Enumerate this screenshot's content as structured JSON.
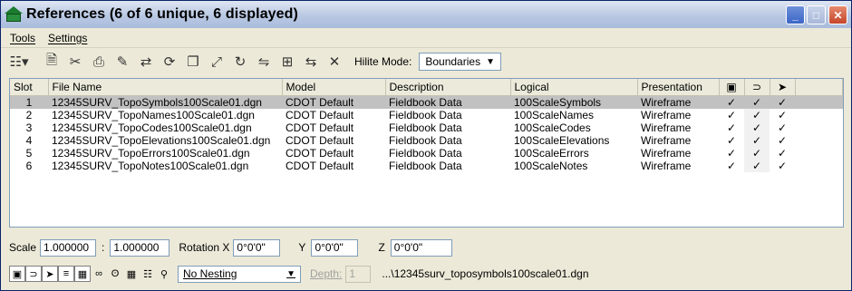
{
  "window": {
    "title": "References (6 of 6 unique, 6 displayed)",
    "minimize_glyph": "_",
    "maximize_glyph": "□",
    "close_glyph": "✕"
  },
  "menu": {
    "items": [
      "Tools",
      "Settings"
    ]
  },
  "toolbar": {
    "icons": [
      "tree-list-icon",
      "attach-icon",
      "detach-icon",
      "print-icon",
      "clip-icon",
      "move-icon",
      "reload-icon",
      "copy-icon",
      "scale-icon",
      "rotate-icon",
      "mirror-icon",
      "merge-icon",
      "exchange-icon",
      "tools-icon"
    ],
    "hilite_label": "Hilite Mode:",
    "hilite_value": "Boundaries"
  },
  "table": {
    "columns": [
      "Slot",
      "File Name",
      "Model",
      "Description",
      "Logical",
      "Presentation",
      "▣",
      "⊃",
      "➤"
    ],
    "rows": [
      {
        "slot": "1",
        "file": "12345SURV_TopoSymbols100Scale01.dgn",
        "model": "CDOT Default",
        "desc": "Fieldbook Data",
        "logical": "100ScaleSymbols",
        "pres": "Wireframe",
        "c1": "✓",
        "c2": "✓",
        "c3": "✓",
        "selected": true
      },
      {
        "slot": "2",
        "file": "12345SURV_TopoNames100Scale01.dgn",
        "model": "CDOT Default",
        "desc": "Fieldbook Data",
        "logical": "100ScaleNames",
        "pres": "Wireframe",
        "c1": "✓",
        "c2": "✓",
        "c3": "✓",
        "selected": false
      },
      {
        "slot": "3",
        "file": "12345SURV_TopoCodes100Scale01.dgn",
        "model": "CDOT Default",
        "desc": "Fieldbook Data",
        "logical": "100ScaleCodes",
        "pres": "Wireframe",
        "c1": "✓",
        "c2": "✓",
        "c3": "✓",
        "selected": false
      },
      {
        "slot": "4",
        "file": "12345SURV_TopoElevations100Scale01.dgn",
        "model": "CDOT Default",
        "desc": "Fieldbook Data",
        "logical": "100ScaleElevations",
        "pres": "Wireframe",
        "c1": "✓",
        "c2": "✓",
        "c3": "✓",
        "selected": false
      },
      {
        "slot": "5",
        "file": "12345SURV_TopoErrors100Scale01.dgn",
        "model": "CDOT Default",
        "desc": "Fieldbook Data",
        "logical": "100ScaleErrors",
        "pres": "Wireframe",
        "c1": "✓",
        "c2": "✓",
        "c3": "✓",
        "selected": false
      },
      {
        "slot": "6",
        "file": "12345SURV_TopoNotes100Scale01.dgn",
        "model": "CDOT Default",
        "desc": "Fieldbook Data",
        "logical": "100ScaleNotes",
        "pres": "Wireframe",
        "c1": "✓",
        "c2": "✓",
        "c3": "✓",
        "selected": false
      }
    ]
  },
  "settings": {
    "scale_label": "Scale",
    "scale_left": "1.000000",
    "scale_sep": ":",
    "scale_right": "1.000000",
    "rotation_label": "Rotation X",
    "rotation_x": "0°0'0\"",
    "y_label": "Y",
    "rotation_y": "0°0'0\"",
    "z_label": "Z",
    "rotation_z": "0°0'0\"",
    "nesting_value": "No Nesting",
    "depth_label": "Depth:",
    "depth_value": "1",
    "path": "...\\12345surv_toposymbols100scale01.dgn"
  },
  "colors": {
    "selected_row": "#c1c1c1",
    "title_gradient_top": "#dfe6f2",
    "close_button": "#c5452a"
  }
}
